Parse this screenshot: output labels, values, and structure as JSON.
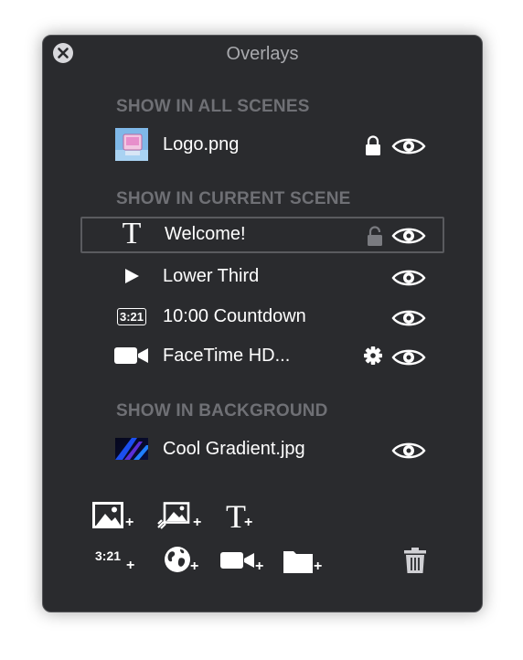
{
  "window": {
    "title": "Overlays"
  },
  "sections": {
    "all": "SHOW IN ALL SCENES",
    "current": "SHOW IN CURRENT SCENE",
    "background": "SHOW IN BACKGROUND"
  },
  "items": {
    "logo": "Logo.png",
    "welcome": "Welcome!",
    "lower_third": "Lower Third",
    "countdown": "10:00 Countdown",
    "countdown_badge": "3:21",
    "facetime": "FaceTime HD...",
    "gradient": "Cool Gradient.jpg"
  },
  "toolbar": {
    "timer_label": "3:21",
    "plus": "+"
  },
  "colors": {
    "panel": "#2a2b2e",
    "section": "#6f7075",
    "text": "#ffffff"
  },
  "icons": [
    "close-icon",
    "lock-icon",
    "unlock-icon",
    "eye-icon",
    "gear-icon",
    "text-icon",
    "play-icon",
    "timer-icon",
    "camera-icon",
    "image-icon",
    "globe-icon",
    "folder-icon",
    "trash-icon"
  ]
}
